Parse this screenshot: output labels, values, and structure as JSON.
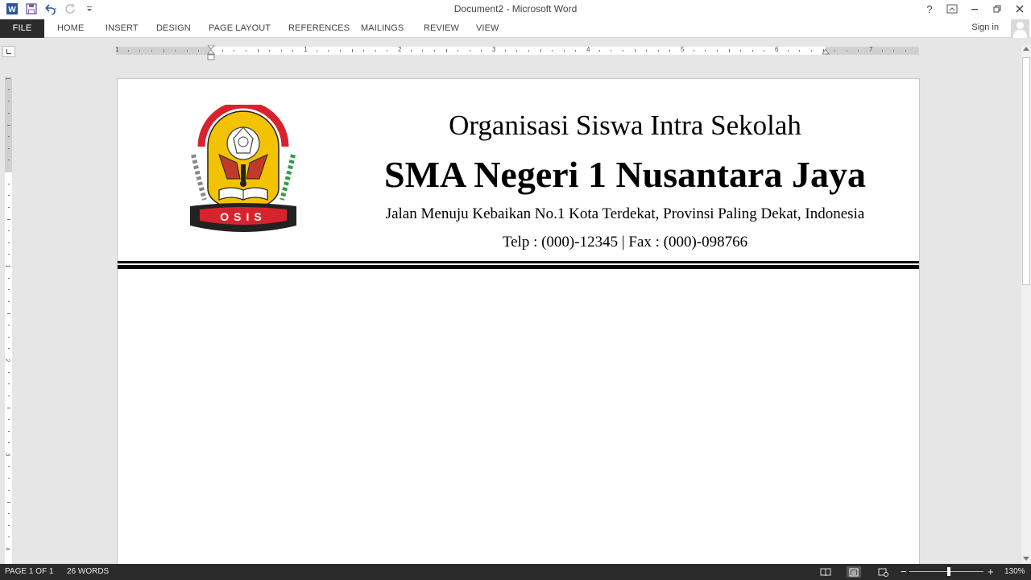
{
  "window": {
    "title": "Document2 - Microsoft Word",
    "help": "?",
    "signin": "Sign in"
  },
  "ribbon": {
    "tabs": [
      "FILE",
      "HOME",
      "INSERT",
      "DESIGN",
      "PAGE LAYOUT",
      "REFERENCES",
      "MAILINGS",
      "REVIEW",
      "VIEW"
    ]
  },
  "ruler": {
    "numbers": [
      "1",
      "1",
      "2",
      "3",
      "4",
      "5",
      "6",
      "7"
    ],
    "vertical_numbers": [
      "1",
      "1",
      "2",
      "3",
      "4"
    ]
  },
  "document": {
    "line1": "Organisasi Siswa Intra Sekolah",
    "line2": "SMA Negeri 1 Nusantara Jaya",
    "line3": "Jalan Menuju Kebaikan No.1 Kota Terdekat, Provinsi Paling Dekat, Indonesia",
    "line4": "Telp : (000)-12345 | Fax : (000)-098766",
    "logo_text": "OSIS"
  },
  "status": {
    "page": "PAGE 1 OF 1",
    "words": "26 WORDS",
    "zoom": "130%",
    "zoom_minus": "−",
    "zoom_plus": "+"
  },
  "colors": {
    "file_tab": "#2b2b2b",
    "word_blue": "#2b579a",
    "status_bar": "#2b2b2b",
    "logo_red": "#d7232e",
    "logo_yellow": "#f3c200"
  }
}
